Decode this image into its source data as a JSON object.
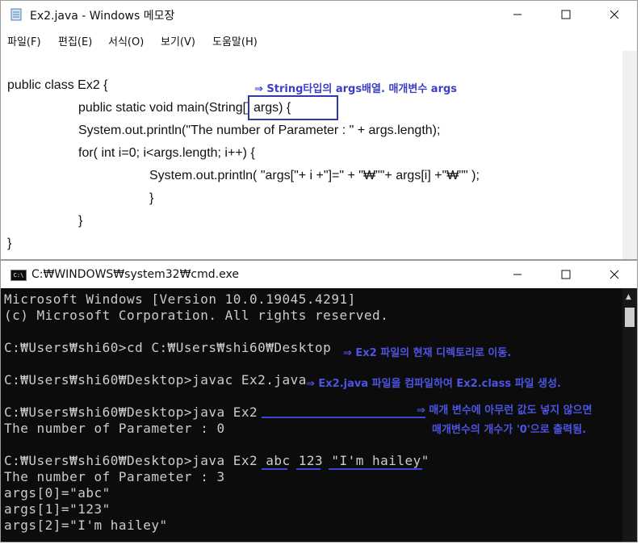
{
  "notepad": {
    "title": "Ex2.java - Windows 메모장",
    "menu": [
      "파일(F)",
      "편집(E)",
      "서식(O)",
      "보기(V)",
      "도움말(H)"
    ],
    "code_lines": [
      "public class Ex2 {",
      "public static void main(String[] args) {",
      "System.out.println(\"The number of Parameter : \" + args.length);",
      "for( int i=0; i<args.length; i++) {",
      "System.out.println( \"args[\"+ i +\"]=\" + \"₩\"\"+ args[i] +\"₩\"\" );",
      "}",
      "}",
      "}"
    ],
    "annotation": "⇒ String타입의 args배열. 매개변수 args"
  },
  "cmd": {
    "title": "C:₩WINDOWS₩system32₩cmd.exe",
    "icon_label": "C:\\",
    "lines": [
      "Microsoft Windows [Version 10.0.19045.4291]",
      "(c) Microsoft Corporation. All rights reserved.",
      "",
      "C:₩Users₩shi60>cd C:₩Users₩shi60₩Desktop",
      "",
      "C:₩Users₩shi60₩Desktop>javac Ex2.java",
      "",
      "C:₩Users₩shi60₩Desktop>java Ex2",
      "The number of Parameter : 0",
      "",
      "C:₩Users₩shi60₩Desktop>java Ex2 abc 123 \"I'm hailey\"",
      "The number of Parameter : 3",
      "args[0]=\"abc\"",
      "args[1]=\"123\"",
      "args[2]=\"I'm hailey\""
    ],
    "annotations": {
      "cd": "⇒ Ex2 파일의 현재 디렉토리로 이동.",
      "javac": "⇒ Ex2.java 파일을 컴파일하여 Ex2.class 파일 생성.",
      "noargs_1": "⇒ 매개 변수에 아무런 값도 넣지 않으면",
      "noargs_2": "매개변수의 개수가 '0'으로 출력됨."
    }
  },
  "icons": {
    "notepad": "notepad-icon",
    "cmd": "cmd-icon",
    "minimize": "minimize-icon",
    "maximize": "maximize-icon",
    "close": "close-icon"
  },
  "colors": {
    "annotation": "#3a3fc6",
    "console_bg": "#0c0c0c",
    "console_text": "#cccccc"
  }
}
